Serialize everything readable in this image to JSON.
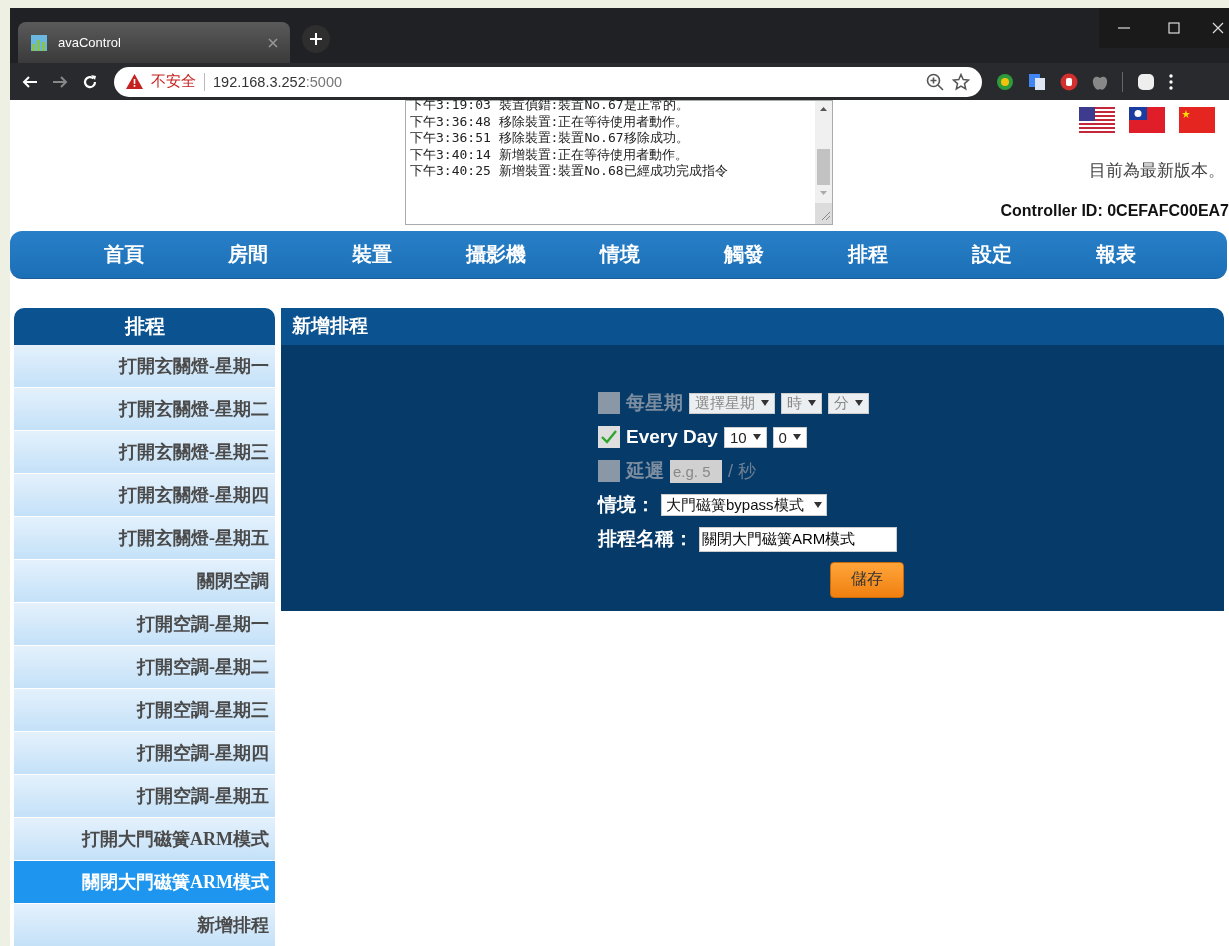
{
  "browser": {
    "tab_title": "avaControl",
    "security_label": "不安全",
    "url_host": "192.168.3.252",
    "url_port": ":5000"
  },
  "log": {
    "lines": [
      "下午3:19:03 裝置偵錯:裝置No.67是正常的。",
      "下午3:36:48 移除裝置:正在等待使用者動作。",
      "下午3:36:51 移除裝置:裝置No.67移除成功。",
      "下午3:40:14 新增裝置:正在等待使用者動作。",
      "下午3:40:25 新增裝置:裝置No.68已經成功完成指令"
    ]
  },
  "header": {
    "version_status": "目前為最新版本。",
    "controller_id": "Controller ID: 0CEFAFC00EA7"
  },
  "nav": {
    "items": [
      "首頁",
      "房間",
      "裝置",
      "攝影機",
      "情境",
      "觸發",
      "排程",
      "設定",
      "報表"
    ]
  },
  "sidebar": {
    "title": "排程",
    "items": [
      {
        "label": "打開玄關燈-星期一",
        "selected": false
      },
      {
        "label": "打開玄關燈-星期二",
        "selected": false
      },
      {
        "label": "打開玄關燈-星期三",
        "selected": false
      },
      {
        "label": "打開玄關燈-星期四",
        "selected": false
      },
      {
        "label": "打開玄關燈-星期五",
        "selected": false
      },
      {
        "label": "關閉空調",
        "selected": false
      },
      {
        "label": "打開空調-星期一",
        "selected": false
      },
      {
        "label": "打開空調-星期二",
        "selected": false
      },
      {
        "label": "打開空調-星期三",
        "selected": false
      },
      {
        "label": "打開空調-星期四",
        "selected": false
      },
      {
        "label": "打開空調-星期五",
        "selected": false
      },
      {
        "label": "打開大門磁簧ARM模式",
        "selected": false
      },
      {
        "label": "關閉大門磁簧ARM模式",
        "selected": true
      },
      {
        "label": "新增排程",
        "selected": false
      }
    ]
  },
  "form": {
    "title": "新增排程",
    "options": [
      {
        "kind": "weekly",
        "checked": false,
        "disabled": true,
        "label": "每星期",
        "selects": [
          "選擇星期",
          "時",
          "分"
        ]
      },
      {
        "kind": "daily",
        "checked": true,
        "disabled": false,
        "label": "Every Day",
        "selects": [
          "10",
          "0"
        ]
      },
      {
        "kind": "delay",
        "checked": false,
        "disabled": true,
        "label": "延遲",
        "placeholder": "e.g. 5",
        "unit": "/ 秒"
      }
    ],
    "scene_label": "情境：",
    "scene_value": "大門磁簧bypass模式",
    "name_label": "排程名稱：",
    "name_value": "關閉大門磁簧ARM模式",
    "save_button": "儲存"
  }
}
